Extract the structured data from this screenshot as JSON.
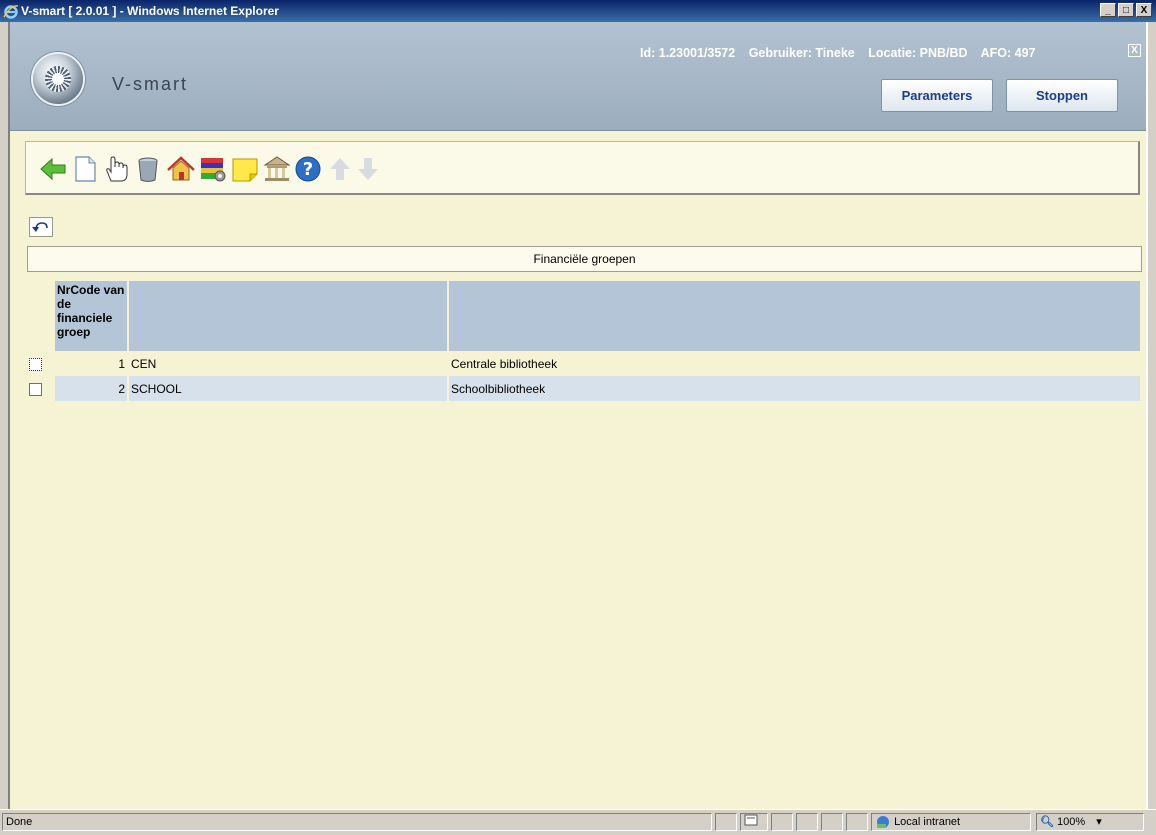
{
  "window": {
    "title": "V-smart [ 2.0.01 ] - Windows Internet Explorer",
    "min": "_",
    "max": "□",
    "close": "X"
  },
  "header": {
    "brand": "V-smart",
    "id_text": "Id: 1.23001/3572",
    "user_text": "Gebruiker: Tineke",
    "location_text": "Locatie: PNB/BD",
    "afo_text": "AFO: 497",
    "close_icon": "X",
    "parameters_label": "Parameters",
    "stop_label": "Stoppen"
  },
  "toolbar": {
    "icons": [
      "back-arrow-icon",
      "new-document-icon",
      "hand-select-icon",
      "delete-bucket-icon",
      "home-icon",
      "settings-books-icon",
      "note-icon",
      "library-building-icon",
      "help-icon",
      "arrow-up-icon",
      "arrow-down-icon"
    ]
  },
  "section": {
    "title": "Financiële groepen"
  },
  "table": {
    "headers": [
      "NrCode van de financiele groep",
      "",
      ""
    ],
    "rows": [
      {
        "nr": "1",
        "code": "CEN",
        "description": "Centrale bibliotheek"
      },
      {
        "nr": "2",
        "code": "SCHOOL",
        "description": "Schoolbibliotheek"
      }
    ]
  },
  "statusbar": {
    "status": "Done",
    "zone": "Local intranet",
    "zoom": "100%"
  },
  "colors": {
    "header_bg": "#a8b8c8",
    "content_bg": "#f6f3d5",
    "row_alt": "#d7e1ec",
    "button_text": "#1b3d8f"
  }
}
